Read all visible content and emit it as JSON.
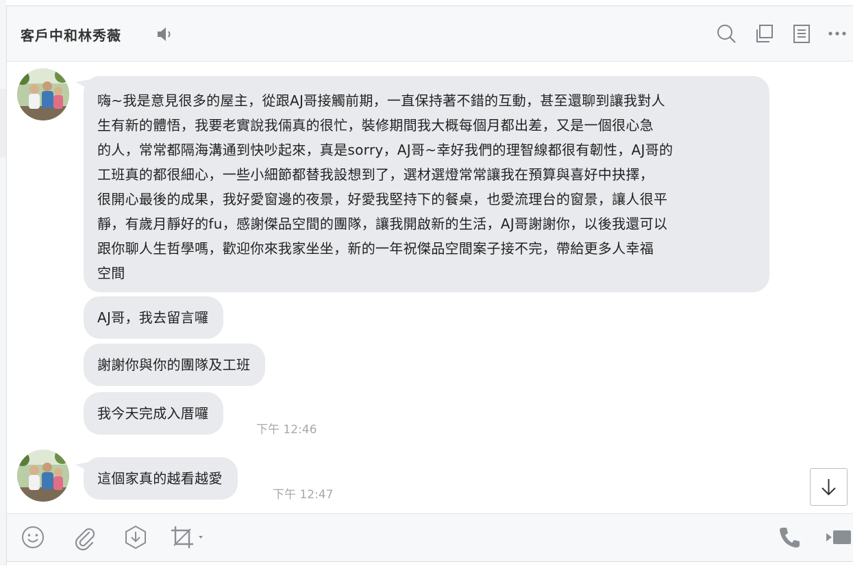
{
  "header": {
    "title": "客戶中和林秀薇",
    "icons": [
      "speaker-icon",
      "search-icon",
      "copy-icon",
      "notes-icon",
      "more-icon"
    ]
  },
  "messages": [
    {
      "lines": [
        "嗨~我是意見很多的屋主，從跟AJ哥接觸前期，一直保持著不錯的互動，甚至還聊到讓我對人",
        "生有新的體悟，我要老實說我倆真的很忙，裝修期間我大概每個月都出差，又是一個很心急",
        "的人，常常都隔海溝通到快吵起來，真是sorry，AJ哥~幸好我們的理智線都很有韌性，AJ哥的",
        "工班真的都很細心，一些小細節都替我設想到了，選材選燈常常讓我在預算與喜好中抉擇，",
        "很開心最後的成果，我好愛窗邊的夜景，好愛我堅持下的餐桌，也愛流理台的窗景，讓人很平",
        "靜，有歲月靜好的fu，感謝傑品空間的團隊，讓我開啟新的生活，AJ哥謝謝你，以後我還可以",
        "跟你聊人生哲學嗎，歡迎你來我家坐坐，新的一年祝傑品空間案子接不完，帶給更多人幸福",
        "空間"
      ]
    },
    {
      "text": "AJ哥，我去留言囉"
    },
    {
      "text": "謝謝你與你的團隊及工班"
    },
    {
      "text": "我今天完成入厝囉",
      "time": "下午 12:46"
    },
    {
      "text": "這個家真的越看越愛",
      "time": "下午 12:47"
    }
  ],
  "footer": {
    "icons": [
      "emoji-icon",
      "attach-icon",
      "download-icon",
      "crop-icon",
      "phone-icon",
      "video-icon"
    ]
  },
  "colors": {
    "bubble": "#e8eaed",
    "header_bg": "#f7f8f9",
    "icon": "#8a8f95",
    "time": "#a5a9ad"
  }
}
